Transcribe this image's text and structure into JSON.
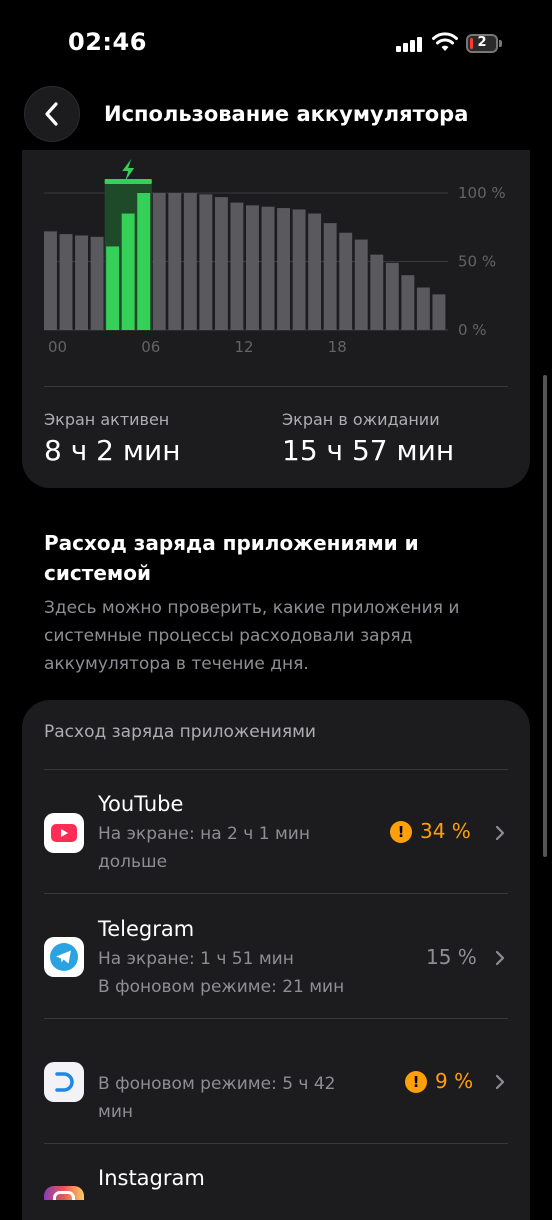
{
  "status_bar": {
    "time": "02:46",
    "battery_level": "2"
  },
  "header": {
    "title": "Использование аккумулятора",
    "back_icon": "chevron-left-icon"
  },
  "chart_data": {
    "type": "bar",
    "y_ticks": [
      "100 %",
      "50 %",
      "0 %"
    ],
    "x_ticks": [
      "00",
      "06",
      "12",
      "18"
    ],
    "ylim": [
      0,
      100
    ],
    "values": [
      72,
      70,
      69,
      68,
      61,
      85,
      100,
      100,
      100,
      100,
      99,
      97,
      93,
      91,
      90,
      89,
      88,
      85,
      78,
      71,
      66,
      55,
      49,
      40,
      31,
      26
    ],
    "charging_bars": [
      4,
      5,
      6
    ],
    "colors": {
      "bar": "#5a5a5e",
      "charging": "#34d058",
      "charging_bg": "#1f4a2a"
    }
  },
  "stats": {
    "screen_on_label": "Экран активен",
    "screen_on_value": "8 ч 2 мин",
    "screen_idle_label": "Экран в ожидании",
    "screen_idle_value": "15 ч 57 мин"
  },
  "section": {
    "title": "Расход заряда приложениями и системой",
    "description": "Здесь можно проверить, какие приложения и системные процессы расходовали заряд аккумулятора в течение дня."
  },
  "apps_card": {
    "title": "Расход заряда приложениями",
    "apps": [
      {
        "name": "YouTube",
        "detail_1": "На экране: на 2 ч 1 мин",
        "detail_2": "дольше",
        "percent": "34 %",
        "warning": true,
        "icon": "youtube-icon"
      },
      {
        "name": "Telegram",
        "detail_1": "На экране: 1 ч 51 мин",
        "detail_2": "В фоновом режиме: 21 мин",
        "percent": "15 %",
        "warning": false,
        "icon": "telegram-icon"
      },
      {
        "name": "",
        "detail_1": "В фоновом режиме: 5 ч 42",
        "detail_2": "мин",
        "percent": "9 %",
        "warning": true,
        "icon": "app-icon"
      },
      {
        "name": "Instagram",
        "icon": "instagram-icon"
      }
    ]
  },
  "colors": {
    "warning": "#ff9f0a",
    "accent_green": "#34d058",
    "card_bg": "#1c1c1e"
  }
}
